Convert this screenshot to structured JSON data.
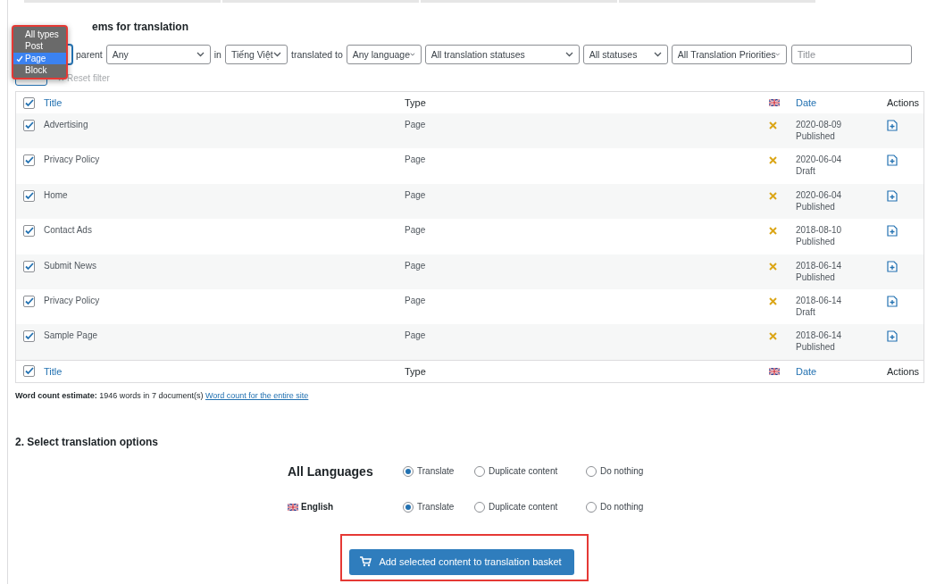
{
  "type_menu": {
    "options": [
      {
        "label": "All types",
        "selected": false
      },
      {
        "label": "Post",
        "selected": false
      },
      {
        "label": "Page",
        "selected": true
      },
      {
        "label": "Block",
        "selected": false
      }
    ]
  },
  "heading_1": "ems for translation",
  "filters": {
    "parent_label": "parent",
    "parent": "Any",
    "in_label": "in",
    "language": "Tiếng Việt",
    "translated_to_label": "translated to",
    "target_language": "Any language",
    "translation_status": "All translation statuses",
    "status": "All statuses",
    "priority": "All Translation Priorities",
    "title_placeholder": "Title",
    "reset": "Reset filter"
  },
  "table": {
    "all_checked": true,
    "columns": [
      {
        "label": "Title",
        "kind": "link"
      },
      {
        "label": "Type",
        "kind": "text"
      },
      {
        "kind": "flag"
      },
      {
        "label": "Date",
        "kind": "link"
      },
      {
        "label": "Actions",
        "kind": "text"
      }
    ],
    "rows": [
      {
        "checked": true,
        "title": "Advertising",
        "type": "Page",
        "translated": false,
        "date": "2020-08-09",
        "status": "Published"
      },
      {
        "checked": true,
        "title": "Privacy Policy",
        "type": "Page",
        "translated": false,
        "date": "2020-06-04",
        "status": "Draft"
      },
      {
        "checked": true,
        "title": "Home",
        "type": "Page",
        "translated": false,
        "date": "2020-06-04",
        "status": "Published"
      },
      {
        "checked": true,
        "title": "Contact Ads",
        "type": "Page",
        "translated": false,
        "date": "2018-08-10",
        "status": "Published"
      },
      {
        "checked": true,
        "title": "Submit News",
        "type": "Page",
        "translated": false,
        "date": "2018-06-14",
        "status": "Published"
      },
      {
        "checked": true,
        "title": "Privacy Policy",
        "type": "Page",
        "translated": false,
        "date": "2018-06-14",
        "status": "Draft"
      },
      {
        "checked": true,
        "title": "Sample Page",
        "type": "Page",
        "translated": false,
        "date": "2018-06-14",
        "status": "Published"
      }
    ],
    "footer_checked": true,
    "footer_columns": [
      {
        "label": "Title",
        "kind": "link"
      },
      {
        "label": "Type",
        "kind": "text"
      },
      {
        "kind": "flag"
      },
      {
        "label": "Date",
        "kind": "link"
      },
      {
        "label": "Actions",
        "kind": "text"
      }
    ]
  },
  "word_count": {
    "text": "**Word count estimate:** 1946 words in 7 document(s)",
    "link": "Word count for the entire site"
  },
  "options": {
    "heading": "2. Select translation options",
    "rows": [
      {
        "kind": "all",
        "label": "All Languages",
        "choices": [
          {
            "label": "Translate",
            "selected": true
          },
          {
            "label": "Duplicate content",
            "selected": false
          },
          {
            "label": "Do nothing",
            "selected": false
          }
        ]
      },
      {
        "kind": "language",
        "label": "English",
        "choices": [
          {
            "label": "Translate",
            "selected": true
          },
          {
            "label": "Duplicate content",
            "selected": false
          },
          {
            "label": "Do nothing",
            "selected": false
          }
        ]
      }
    ]
  },
  "basket_button": "Add selected content to translation basket"
}
